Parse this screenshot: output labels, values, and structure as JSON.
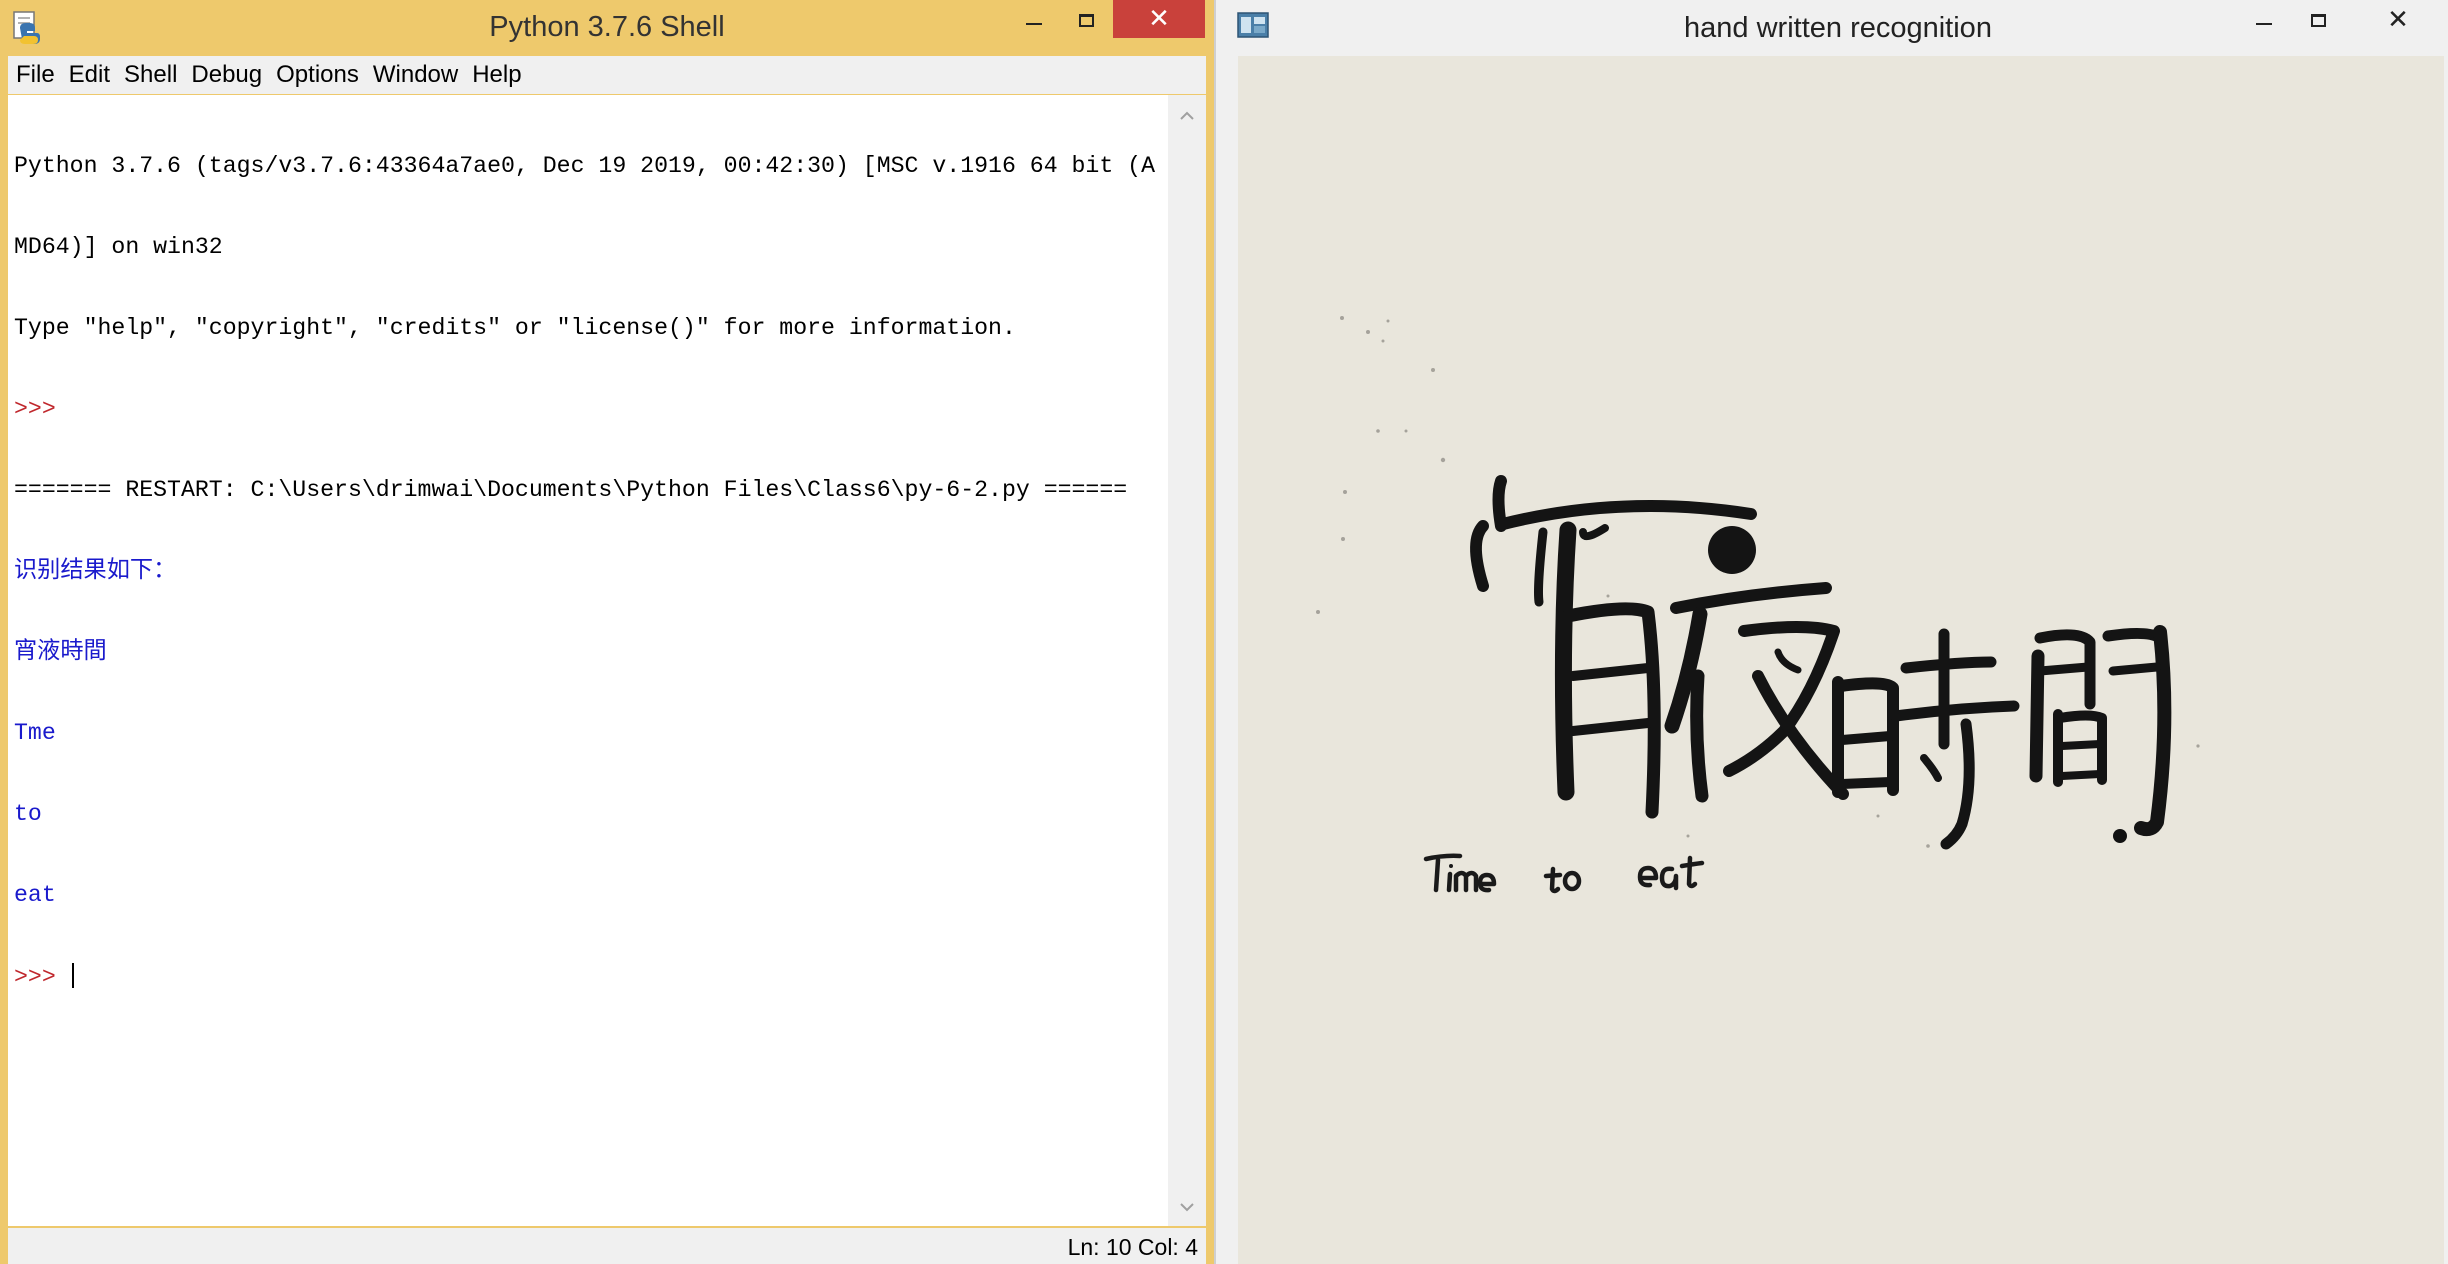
{
  "shell": {
    "title": "Python 3.7.6 Shell",
    "menu": [
      "File",
      "Edit",
      "Shell",
      "Debug",
      "Options",
      "Window",
      "Help"
    ],
    "lines": [
      {
        "text": "Python 3.7.6 (tags/v3.7.6:43364a7ae0, Dec 19 2019, 00:42:30) [MSC v.1916 64 bit (A",
        "kind": "normal"
      },
      {
        "text": "MD64)] on win32",
        "kind": "normal"
      },
      {
        "text": "Type \"help\", \"copyright\", \"credits\" or \"license()\" for more information.",
        "kind": "normal"
      },
      {
        "text": ">>> ",
        "kind": "prompt"
      },
      {
        "text": "======= RESTART: C:\\Users\\drimwai\\Documents\\Python Files\\Class6\\py-6-2.py ======",
        "kind": "normal"
      },
      {
        "text": "识别结果如下：",
        "kind": "output"
      },
      {
        "text": "宵液時間",
        "kind": "output"
      },
      {
        "text": "Tme",
        "kind": "output"
      },
      {
        "text": "to",
        "kind": "output"
      },
      {
        "text": "eat",
        "kind": "output"
      }
    ],
    "final_prompt": ">>> ",
    "status": "Ln: 10 Col: 4",
    "colors": {
      "prompt": "#c0282d",
      "output": "#1a1acc",
      "titlebar": "#eec96c",
      "close": "#c9413b"
    }
  },
  "recognizer": {
    "title": "hand written recognition",
    "image": {
      "chinese_text": "宵夜時間",
      "english_text": "Time to eat"
    }
  },
  "icons": [
    "python-idle-icon",
    "minimize-icon",
    "maximize-icon",
    "close-icon",
    "scroll-up-arrow-icon",
    "scroll-down-arrow-icon",
    "tk-window-icon"
  ]
}
